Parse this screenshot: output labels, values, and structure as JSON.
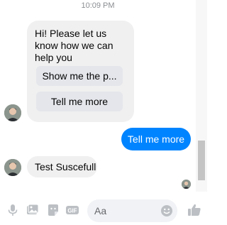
{
  "conversation": {
    "timestamp": "10:09 PM",
    "bot_card": {
      "greeting": "Hi! Please let us know how we can help you",
      "quick_replies": [
        "Show me the p...",
        "Tell me more"
      ]
    },
    "user_message": "Tell me more",
    "bot_reply": "Test Suscefull"
  },
  "composer": {
    "placeholder": "Aa",
    "icons": [
      "microphone-icon",
      "photo-icon",
      "sticker-icon",
      "gif-icon",
      "emoji-icon",
      "thumbs-up-icon"
    ],
    "gif_label": "GIF"
  },
  "colors": {
    "user_bubble": "#0084ff",
    "bot_bubble": "#f0f0f0",
    "quick_reply": "#e4e6eb",
    "icon": "#bcc0c4"
  }
}
